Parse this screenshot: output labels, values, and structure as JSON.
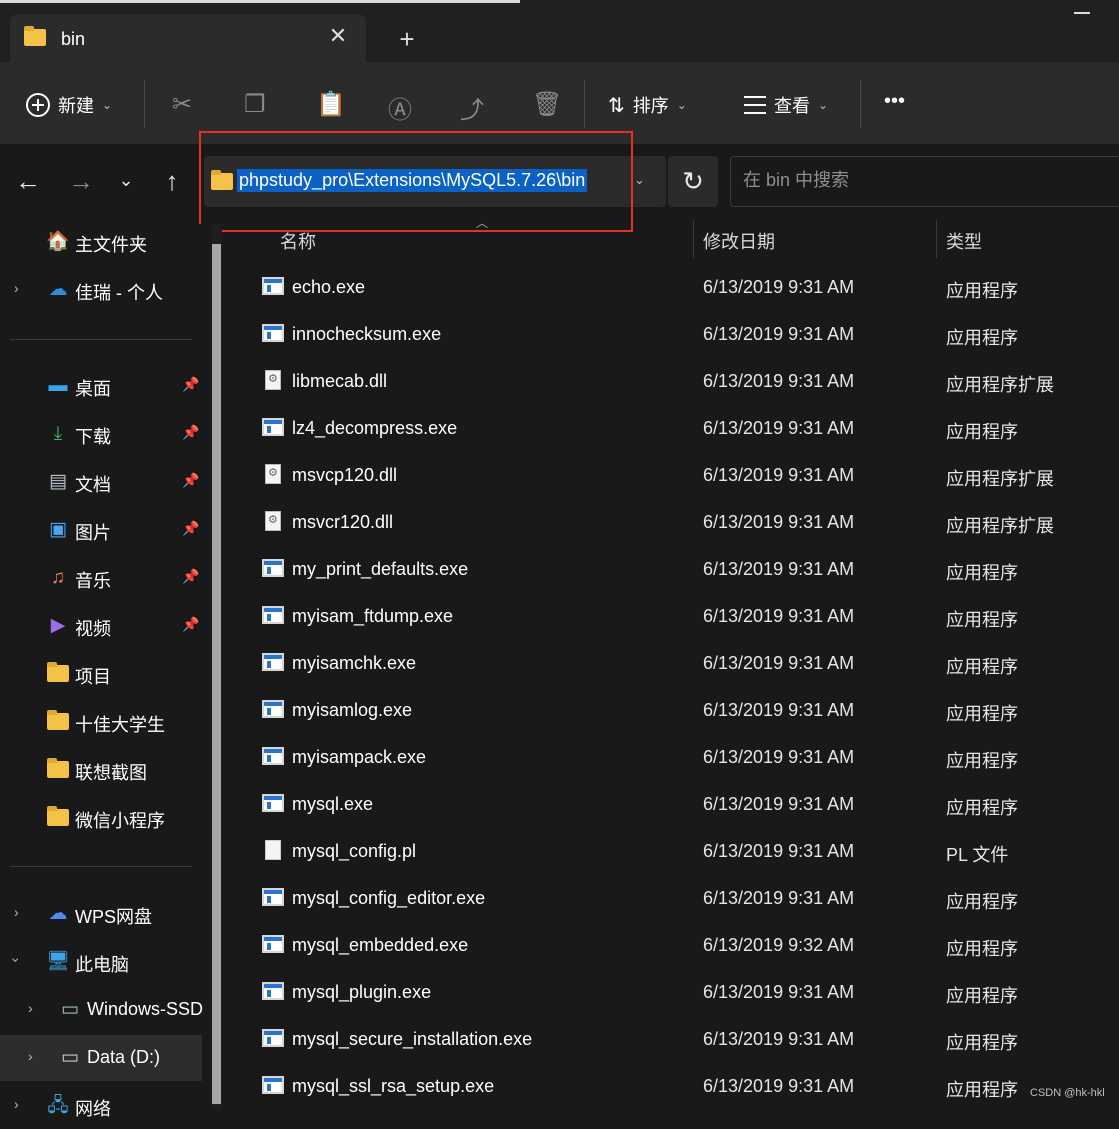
{
  "window": {
    "tab_title": "bin",
    "tab_close": "✕",
    "new_tab": "+"
  },
  "toolbar": {
    "new_label": "新建",
    "sort_label": "排序",
    "view_label": "查看",
    "more": "•••",
    "chevron": "⌄"
  },
  "nav": {
    "back": "←",
    "forward": "→",
    "recent": "⌄",
    "up": "↑",
    "path": "phpstudy_pro\\Extensions\\MySQL5.7.26\\bin",
    "path_dropdown": "⌄",
    "refresh": "↻",
    "search_placeholder": "在 bin 中搜索"
  },
  "sidebar": {
    "home": "主文件夹",
    "cloud": "佳瑞 - 个人",
    "quick": [
      {
        "label": "桌面",
        "icon": "desktop-icon"
      },
      {
        "label": "下载",
        "icon": "download-icon"
      },
      {
        "label": "文档",
        "icon": "document-icon"
      },
      {
        "label": "图片",
        "icon": "pictures-icon"
      },
      {
        "label": "音乐",
        "icon": "music-icon"
      },
      {
        "label": "视频",
        "icon": "video-icon"
      }
    ],
    "folders": [
      "项目",
      "十佳大学生",
      "联想截图",
      "微信小程序"
    ],
    "wps": "WPS网盘",
    "this_pc": "此电脑",
    "drive_c": "Windows-SSD",
    "drive_d": "Data (D:)",
    "network": "网络"
  },
  "columns": {
    "name": "名称",
    "modified": "修改日期",
    "type": "类型"
  },
  "files": [
    {
      "name": "echo.exe",
      "date": "6/13/2019 9:31 AM",
      "type": "应用程序",
      "kind": "exe"
    },
    {
      "name": "innochecksum.exe",
      "date": "6/13/2019 9:31 AM",
      "type": "应用程序",
      "kind": "exe"
    },
    {
      "name": "libmecab.dll",
      "date": "6/13/2019 9:31 AM",
      "type": "应用程序扩展",
      "kind": "dll"
    },
    {
      "name": "lz4_decompress.exe",
      "date": "6/13/2019 9:31 AM",
      "type": "应用程序",
      "kind": "exe"
    },
    {
      "name": "msvcp120.dll",
      "date": "6/13/2019 9:31 AM",
      "type": "应用程序扩展",
      "kind": "dll"
    },
    {
      "name": "msvcr120.dll",
      "date": "6/13/2019 9:31 AM",
      "type": "应用程序扩展",
      "kind": "dll"
    },
    {
      "name": "my_print_defaults.exe",
      "date": "6/13/2019 9:31 AM",
      "type": "应用程序",
      "kind": "exe"
    },
    {
      "name": "myisam_ftdump.exe",
      "date": "6/13/2019 9:31 AM",
      "type": "应用程序",
      "kind": "exe"
    },
    {
      "name": "myisamchk.exe",
      "date": "6/13/2019 9:31 AM",
      "type": "应用程序",
      "kind": "exe"
    },
    {
      "name": "myisamlog.exe",
      "date": "6/13/2019 9:31 AM",
      "type": "应用程序",
      "kind": "exe"
    },
    {
      "name": "myisampack.exe",
      "date": "6/13/2019 9:31 AM",
      "type": "应用程序",
      "kind": "exe"
    },
    {
      "name": "mysql.exe",
      "date": "6/13/2019 9:31 AM",
      "type": "应用程序",
      "kind": "exe"
    },
    {
      "name": "mysql_config.pl",
      "date": "6/13/2019 9:31 AM",
      "type": "PL 文件",
      "kind": "file"
    },
    {
      "name": "mysql_config_editor.exe",
      "date": "6/13/2019 9:31 AM",
      "type": "应用程序",
      "kind": "exe"
    },
    {
      "name": "mysql_embedded.exe",
      "date": "6/13/2019 9:32 AM",
      "type": "应用程序",
      "kind": "exe"
    },
    {
      "name": "mysql_plugin.exe",
      "date": "6/13/2019 9:31 AM",
      "type": "应用程序",
      "kind": "exe"
    },
    {
      "name": "mysql_secure_installation.exe",
      "date": "6/13/2019 9:31 AM",
      "type": "应用程序",
      "kind": "exe"
    },
    {
      "name": "mysql_ssl_rsa_setup.exe",
      "date": "6/13/2019 9:31 AM",
      "type": "应用程序",
      "kind": "exe"
    }
  ],
  "watermark": "CSDN @hk-hkl",
  "colors": {
    "accent_selection": "#0b62c4",
    "highlight_box": "#e3341e",
    "folder": "#f3c247"
  }
}
